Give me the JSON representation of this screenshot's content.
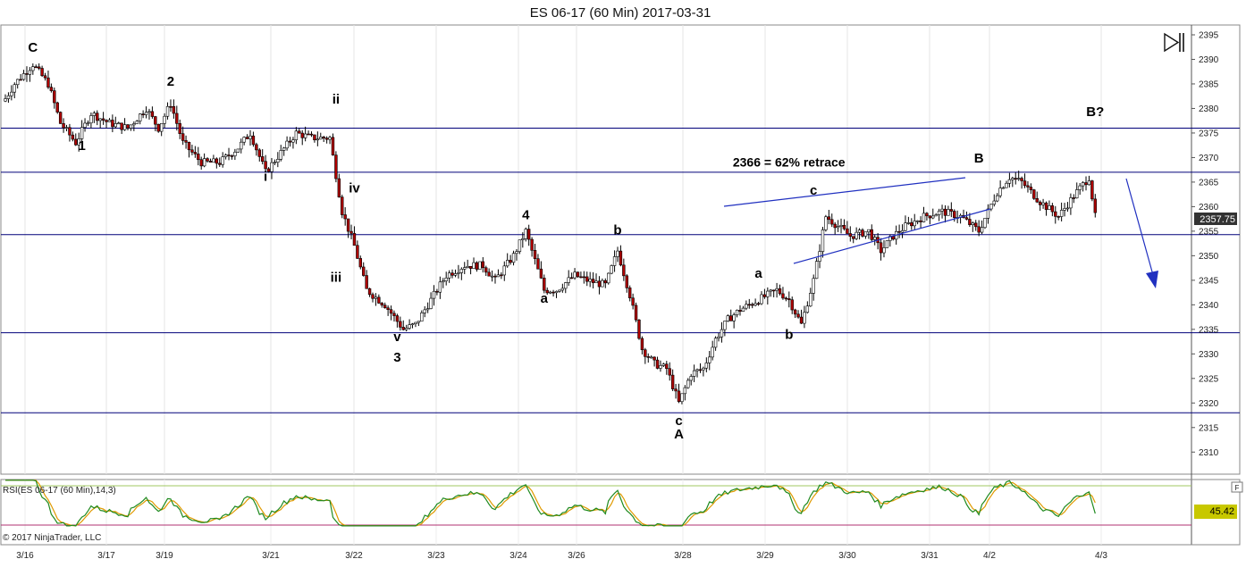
{
  "header": {
    "title": "ES 06-17 (60 Min)  2017-03-31"
  },
  "colors": {
    "background": "#ffffff",
    "up_candle": "#ffffff",
    "down_candle": "#b00000",
    "level_line": "#00007a",
    "trend_line": "#2030c0",
    "rsi_line": "#1f8a1f",
    "rsi_signal": "#e09a00",
    "rsi_band": "#a0c860",
    "rsi_low_band": "#b03070",
    "price_badge": "#333333",
    "rsi_badge": "#c8c800"
  },
  "icons": {
    "chart_nav": "skip-to-end-icon"
  },
  "chart_data": {
    "type": "candlestick",
    "title": "ES 06-17 (60 Min)  2017-03-31",
    "y_ticks": [
      2310,
      2315,
      2320,
      2325,
      2330,
      2335,
      2340,
      2345,
      2350,
      2355,
      2360,
      2365,
      2370,
      2375,
      2380,
      2385,
      2390,
      2395
    ],
    "ylim": [
      2305.5,
      2397
    ],
    "x_ticks": [
      "3/16",
      "3/17",
      "3/19",
      "3/21",
      "3/22",
      "3/23",
      "3/24",
      "3/26",
      "3/28",
      "3/29",
      "3/30",
      "3/31",
      "4/2",
      "4/3"
    ],
    "last_price": "2357.75",
    "horizontal_levels": [
      2376,
      2367,
      2354.3,
      2334.3,
      2318
    ],
    "price_path": [
      [
        0,
        2382
      ],
      [
        3,
        2385
      ],
      [
        9,
        2389
      ],
      [
        14,
        2385
      ],
      [
        18,
        2377
      ],
      [
        23,
        2373
      ],
      [
        28,
        2379
      ],
      [
        34,
        2377
      ],
      [
        40,
        2376
      ],
      [
        46,
        2380
      ],
      [
        50,
        2376
      ],
      [
        54,
        2381
      ],
      [
        58,
        2373
      ],
      [
        64,
        2369
      ],
      [
        70,
        2369
      ],
      [
        76,
        2372
      ],
      [
        80,
        2375
      ],
      [
        85,
        2367
      ],
      [
        90,
        2371
      ],
      [
        95,
        2375
      ],
      [
        100,
        2374
      ],
      [
        106,
        2374
      ],
      [
        110,
        2359
      ],
      [
        114,
        2352
      ],
      [
        118,
        2343
      ],
      [
        124,
        2340
      ],
      [
        130,
        2335
      ],
      [
        134,
        2336
      ],
      [
        138,
        2340
      ],
      [
        144,
        2346
      ],
      [
        150,
        2348
      ],
      [
        156,
        2348
      ],
      [
        160,
        2345
      ],
      [
        166,
        2350
      ],
      [
        170,
        2355
      ],
      [
        176,
        2343
      ],
      [
        180,
        2343
      ],
      [
        186,
        2346
      ],
      [
        190,
        2345
      ],
      [
        196,
        2344
      ],
      [
        200,
        2351
      ],
      [
        204,
        2342
      ],
      [
        208,
        2331
      ],
      [
        212,
        2328
      ],
      [
        216,
        2327
      ],
      [
        220,
        2320
      ],
      [
        224,
        2326
      ],
      [
        228,
        2327
      ],
      [
        232,
        2333
      ],
      [
        236,
        2337
      ],
      [
        240,
        2339
      ],
      [
        246,
        2341
      ],
      [
        252,
        2343
      ],
      [
        256,
        2341
      ],
      [
        260,
        2336
      ],
      [
        264,
        2345
      ],
      [
        268,
        2358
      ],
      [
        272,
        2356
      ],
      [
        276,
        2354
      ],
      [
        282,
        2355
      ],
      [
        286,
        2351
      ],
      [
        290,
        2354
      ],
      [
        294,
        2356
      ],
      [
        300,
        2358
      ],
      [
        306,
        2359
      ],
      [
        312,
        2358
      ],
      [
        318,
        2355
      ],
      [
        324,
        2363
      ],
      [
        328,
        2366
      ],
      [
        332,
        2365
      ],
      [
        338,
        2361
      ],
      [
        344,
        2358
      ],
      [
        350,
        2363
      ],
      [
        354,
        2366
      ],
      [
        356,
        2358
      ]
    ],
    "wave_labels": [
      {
        "text": "C",
        "x": 9,
        "price": 2391.5
      },
      {
        "text": "1",
        "x": 25,
        "price": 2371.5
      },
      {
        "text": "2",
        "x": 54,
        "price": 2384.6
      },
      {
        "text": "i",
        "x": 85,
        "price": 2365.3
      },
      {
        "text": "ii",
        "x": 108,
        "price": 2381
      },
      {
        "text": "iv",
        "x": 114,
        "price": 2362.9
      },
      {
        "text": "iii",
        "x": 108,
        "price": 2344.7
      },
      {
        "text": "v",
        "x": 128,
        "price": 2332.6
      },
      {
        "text": "3",
        "x": 128,
        "price": 2328.4
      },
      {
        "text": "4",
        "x": 170,
        "price": 2357.4
      },
      {
        "text": "a",
        "x": 176,
        "price": 2340.4
      },
      {
        "text": "b",
        "x": 200,
        "price": 2354.3
      },
      {
        "text": "c",
        "x": 220,
        "price": 2315.5
      },
      {
        "text": "A",
        "x": 220,
        "price": 2312.8
      },
      {
        "text": "a",
        "x": 246,
        "price": 2345.5
      },
      {
        "text": "b",
        "x": 256,
        "price": 2333.1
      },
      {
        "text": "c",
        "x": 264,
        "price": 2362.4
      },
      {
        "text": "B",
        "x": 318,
        "price": 2369
      },
      {
        "text": "B?",
        "x": 356,
        "price": 2378.4
      }
    ],
    "annotations": [
      {
        "text": "2366 = 62% retrace",
        "x": 282,
        "price": 2368.2
      }
    ],
    "indicator": {
      "label": "RSI(ES 06-17 (60 Min),14,3)",
      "current_value": "45.42",
      "signal_value": "46.66",
      "upper_band": 70,
      "lower_band": 30
    },
    "watermark": "© 2017 NinjaTrader, LLC"
  }
}
